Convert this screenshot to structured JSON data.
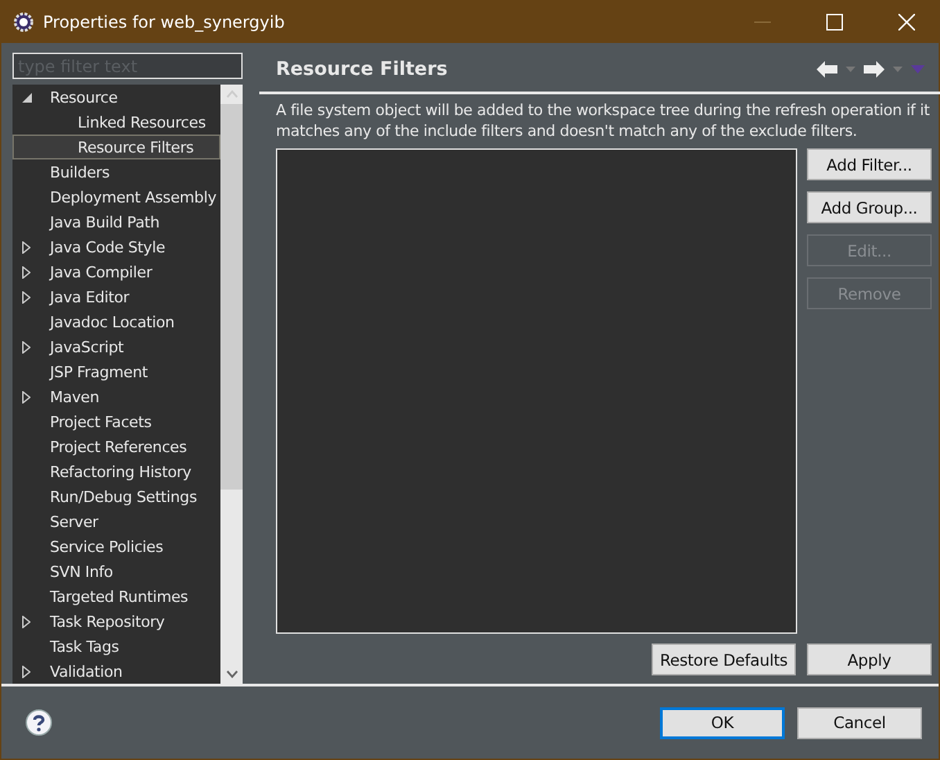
{
  "window": {
    "title": "Properties for web_synergyib"
  },
  "filter": {
    "placeholder": "type filter text"
  },
  "tree": [
    {
      "label": "Resource",
      "kind": "group",
      "expanded": true,
      "selected": false,
      "children": [
        {
          "label": "Linked Resources",
          "kind": "leaf",
          "selected": false
        },
        {
          "label": "Resource Filters",
          "kind": "leaf",
          "selected": true
        }
      ]
    },
    {
      "label": "Builders",
      "kind": "leaf",
      "selected": false
    },
    {
      "label": "Deployment Assembly",
      "kind": "leaf",
      "selected": false
    },
    {
      "label": "Java Build Path",
      "kind": "leaf",
      "selected": false
    },
    {
      "label": "Java Code Style",
      "kind": "group",
      "expanded": false,
      "selected": false
    },
    {
      "label": "Java Compiler",
      "kind": "group",
      "expanded": false,
      "selected": false
    },
    {
      "label": "Java Editor",
      "kind": "group",
      "expanded": false,
      "selected": false
    },
    {
      "label": "Javadoc Location",
      "kind": "leaf",
      "selected": false
    },
    {
      "label": "JavaScript",
      "kind": "group",
      "expanded": false,
      "selected": false
    },
    {
      "label": "JSP Fragment",
      "kind": "leaf",
      "selected": false
    },
    {
      "label": "Maven",
      "kind": "group",
      "expanded": false,
      "selected": false
    },
    {
      "label": "Project Facets",
      "kind": "leaf",
      "selected": false
    },
    {
      "label": "Project References",
      "kind": "leaf",
      "selected": false
    },
    {
      "label": "Refactoring History",
      "kind": "leaf",
      "selected": false
    },
    {
      "label": "Run/Debug Settings",
      "kind": "leaf",
      "selected": false
    },
    {
      "label": "Server",
      "kind": "leaf",
      "selected": false
    },
    {
      "label": "Service Policies",
      "kind": "leaf",
      "selected": false
    },
    {
      "label": "SVN Info",
      "kind": "leaf",
      "selected": false
    },
    {
      "label": "Targeted Runtimes",
      "kind": "leaf",
      "selected": false
    },
    {
      "label": "Task Repository",
      "kind": "group",
      "expanded": false,
      "selected": false
    },
    {
      "label": "Task Tags",
      "kind": "leaf",
      "selected": false
    },
    {
      "label": "Validation",
      "kind": "group",
      "expanded": false,
      "selected": false
    }
  ],
  "page": {
    "title": "Resource Filters",
    "description": "A file system object will be added to the workspace tree during the refresh operation if it matches any of the include filters and doesn't match any of the exclude filters.",
    "buttons": [
      {
        "label": "Add Filter...",
        "disabled": false
      },
      {
        "label": "Add Group...",
        "disabled": false
      },
      {
        "label": "Edit...",
        "disabled": true
      },
      {
        "label": "Remove",
        "disabled": true
      }
    ],
    "footer_buttons": [
      "Restore Defaults",
      "Apply"
    ]
  },
  "dialog_buttons": [
    {
      "label": "OK",
      "default": true
    },
    {
      "label": "Cancel",
      "default": false
    }
  ]
}
